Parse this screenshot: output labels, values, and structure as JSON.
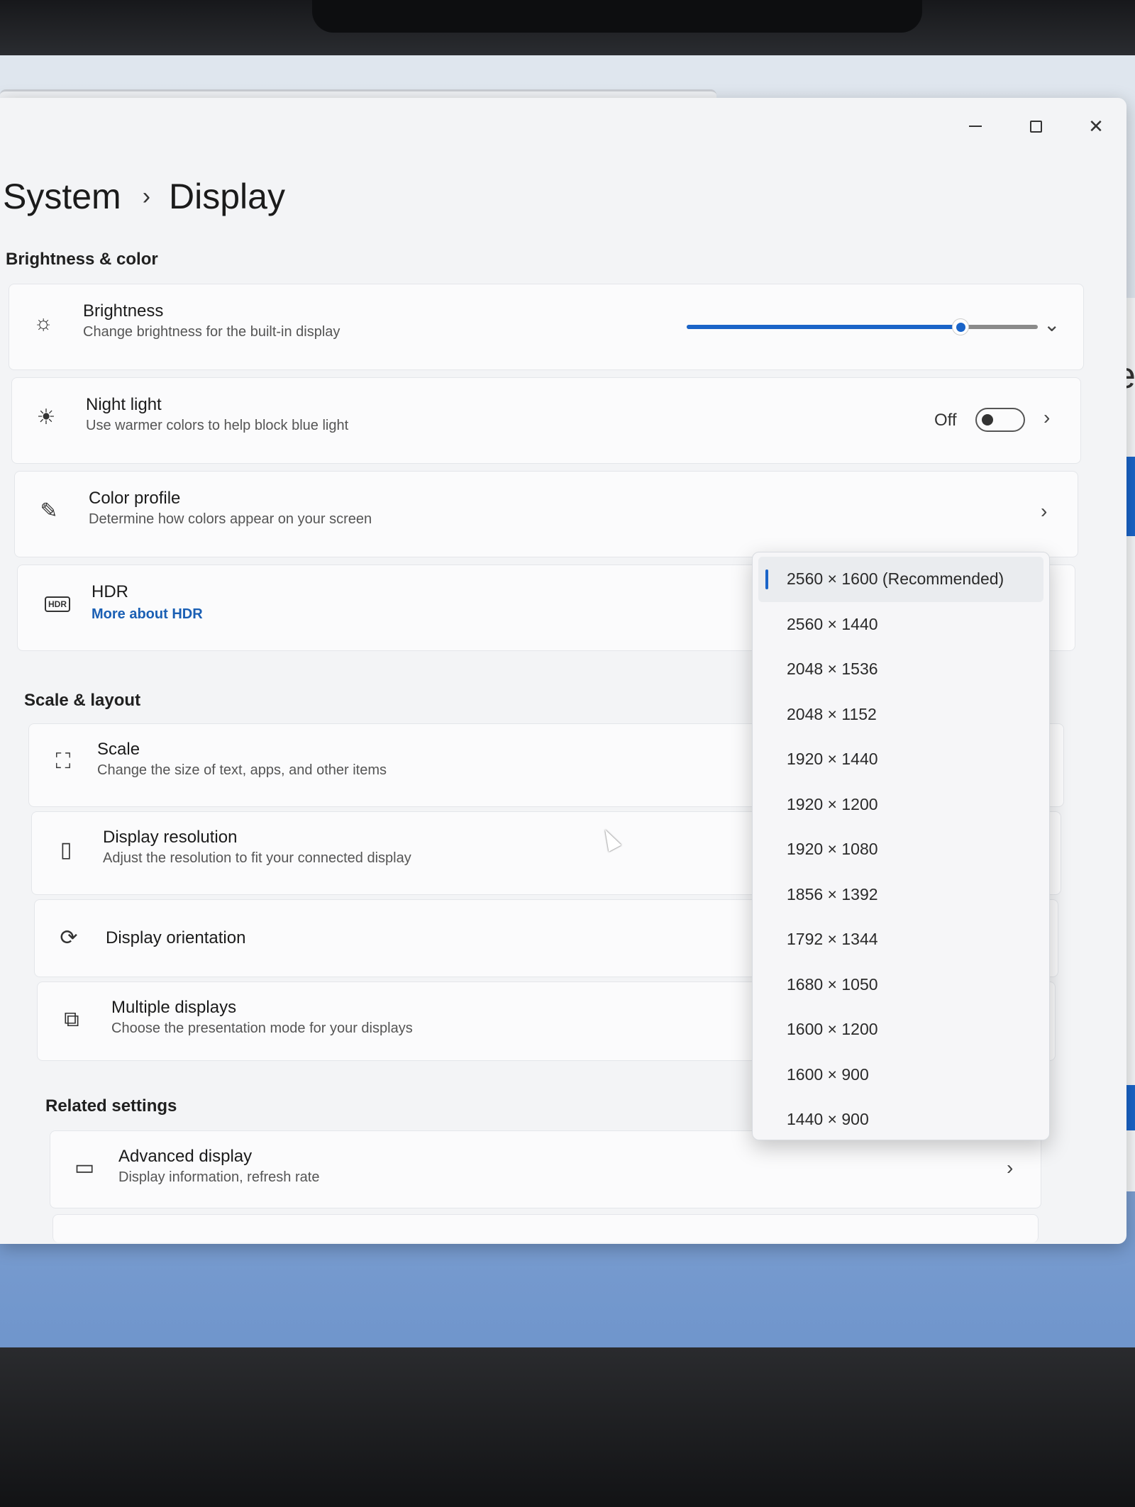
{
  "breadcrumb": {
    "parent": "System",
    "separator": "›",
    "current": "Display"
  },
  "sections": {
    "brightness_color": "Brightness & color",
    "scale_layout": "Scale & layout",
    "related": "Related settings"
  },
  "brightness": {
    "title": "Brightness",
    "subtitle": "Change brightness for the built-in display",
    "level": 0.78,
    "expand_glyph": "⌄"
  },
  "night_light": {
    "title": "Night light",
    "subtitle": "Use warmer colors to help block blue light",
    "state": "Off"
  },
  "color_profile": {
    "title": "Color profile",
    "subtitle": "Determine how colors appear on your screen"
  },
  "hdr": {
    "title": "HDR",
    "link": "More about HDR",
    "badge": "HDR"
  },
  "scale": {
    "title": "Scale",
    "subtitle": "Change the size of text, apps, and other items"
  },
  "resolution": {
    "title": "Display resolution",
    "subtitle": "Adjust the resolution to fit your connected display"
  },
  "orientation": {
    "title": "Display orientation"
  },
  "multiple": {
    "title": "Multiple displays",
    "subtitle": "Choose the presentation mode for your displays"
  },
  "advanced": {
    "title": "Advanced display",
    "subtitle": "Display information, refresh rate"
  },
  "dropdown": {
    "options": [
      "2560 × 1600 (Recommended)",
      "2560 × 1440",
      "2048 × 1536",
      "2048 × 1152",
      "1920 × 1440",
      "1920 × 1200",
      "1920 × 1080",
      "1856 × 1392",
      "1792 × 1344",
      "1680 × 1050",
      "1600 × 1200",
      "1600 × 900",
      "1440 × 900"
    ],
    "selected_index": 0
  },
  "colors": {
    "accent": "#1a64c8",
    "link": "#1a5fb4"
  },
  "window_controls": {
    "close_glyph": "✕"
  }
}
